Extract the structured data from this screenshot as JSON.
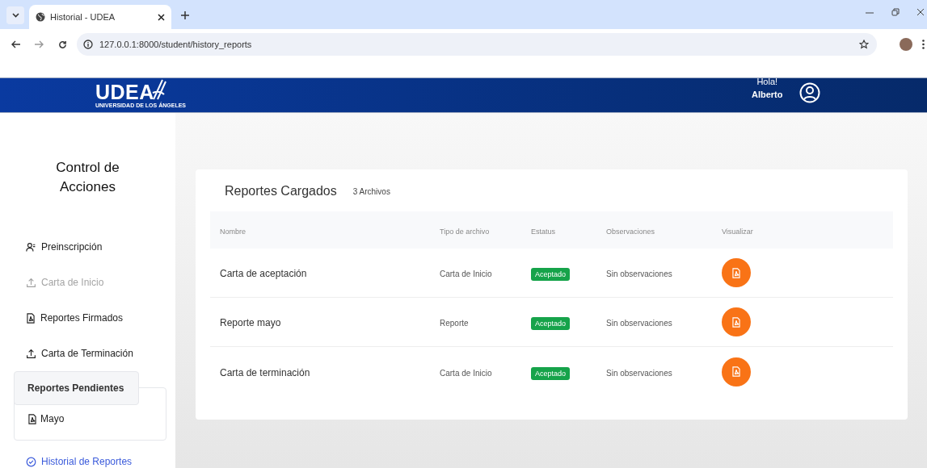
{
  "browser": {
    "tab": {
      "title": "Historial - UDEA",
      "selected": true
    },
    "url": "127.0.0.1:8000/student/history_reports"
  },
  "header": {
    "logo_text": "UDEA",
    "logo_subtitle": "UNIVERSIDAD DE LOS ÁNGELES",
    "greeting": "Hola!",
    "user_name": "Alberto"
  },
  "sidebar": {
    "title": "Control de Acciones",
    "items": [
      {
        "kind": "profile",
        "label": "Preinscripción",
        "disabled": false,
        "selected": false
      },
      {
        "kind": "upload",
        "label": "Carta de Inicio",
        "disabled": true,
        "selected": false
      },
      {
        "kind": "document",
        "label": "Reportes Firmados",
        "disabled": false,
        "selected": false
      },
      {
        "kind": "upload",
        "label": "Carta de Terminación",
        "disabled": false,
        "selected": false
      },
      {
        "kind": "group",
        "label": "Reportes Pendientes",
        "children": [
          {
            "kind": "document",
            "label": "Mayo"
          }
        ]
      },
      {
        "kind": "history",
        "label": "Historial de Reportes",
        "disabled": false,
        "selected": true
      }
    ]
  },
  "main": {
    "title": "Reportes Cargados",
    "count": "3 Archivos",
    "table": {
      "columns": [
        "Nombre",
        "Tipo de archivo",
        "Estatus",
        "Observaciones",
        "Visualizar"
      ],
      "rows": [
        {
          "name": "Carta de aceptación",
          "type": "Carta de Inicio",
          "status": "Aceptado",
          "observations": "Sin observaciones"
        },
        {
          "name": "Reporte mayo",
          "type": "Reporte",
          "status": "Aceptado",
          "observations": "Sin observaciones"
        },
        {
          "name": "Carta de terminación",
          "type": "Carta de Inicio",
          "status": "Aceptado",
          "observations": "Sin observaciones"
        }
      ]
    }
  }
}
